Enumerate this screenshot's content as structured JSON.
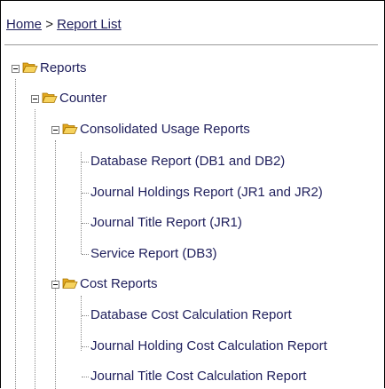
{
  "breadcrumb": {
    "home": "Home",
    "separator": ">",
    "current": "Report List"
  },
  "tree": {
    "root_label": "Reports",
    "counter_label": "Counter",
    "consolidated_label": "Consolidated Usage Reports",
    "consolidated_items": [
      "Database Report (DB1 and DB2)",
      "Journal Holdings Report (JR1 and JR2)",
      "Journal Title Report (JR1)",
      "Service Report (DB3)"
    ],
    "cost_label": "Cost Reports",
    "cost_items": [
      "Database Cost Calculation Report",
      "Journal Holding Cost Calculation Report",
      "Journal Title Cost Calculation Report"
    ]
  },
  "colors": {
    "link": "#1f1f5c",
    "folder": "#f2c64a"
  },
  "icons": {
    "expanded": "minus-box-icon",
    "folder": "open-folder-icon"
  }
}
